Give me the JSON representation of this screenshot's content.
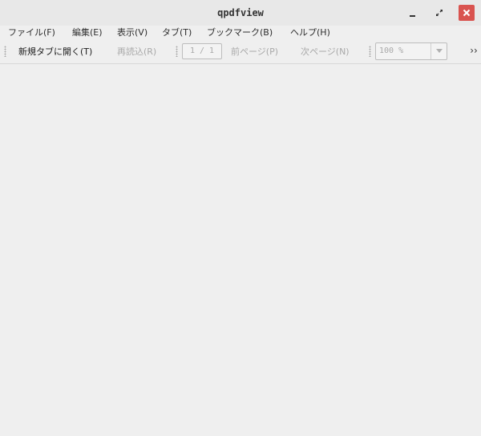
{
  "window": {
    "title": "qpdfview"
  },
  "menubar": {
    "items": [
      {
        "label": "ファイル(F)"
      },
      {
        "label": "編集(E)"
      },
      {
        "label": "表示(V)"
      },
      {
        "label": "タブ(T)"
      },
      {
        "label": "ブックマーク(B)"
      },
      {
        "label": "ヘルプ(H)"
      }
    ]
  },
  "toolbar": {
    "open_in_new_tab_label": "新規タブに開く(T)",
    "refresh_label": "再読込(R)",
    "page_indicator": "1 / 1",
    "previous_page_label": "前ページ(P)",
    "next_page_label": "次ページ(N)",
    "zoom_value": "100 %",
    "overflow_label": "››"
  },
  "colors": {
    "close_button": "#d9534f",
    "disabled_text": "#a9a9a9",
    "background": "#efefef"
  },
  "icons": {
    "minimize": "minimize-icon",
    "maximize": "maximize-icon",
    "close": "close-icon",
    "zoom_dropdown": "chevron-down-icon"
  }
}
